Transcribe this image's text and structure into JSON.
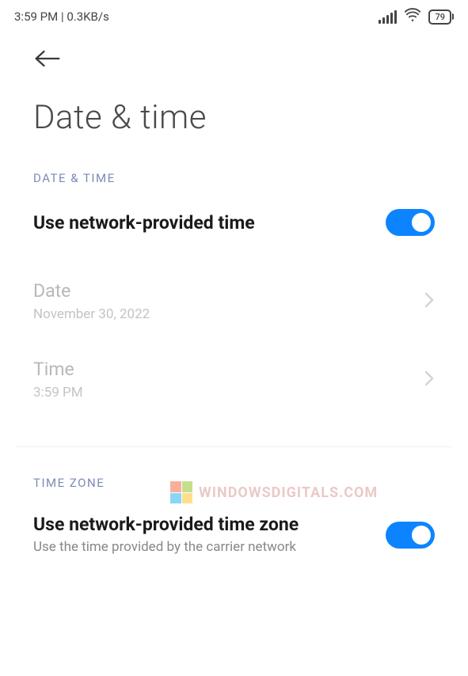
{
  "status_bar": {
    "time": "3:59 PM",
    "data_rate": "0.3KB/s",
    "battery": "79"
  },
  "page": {
    "title": "Date & time"
  },
  "sections": {
    "date_time": {
      "header": "DATE & TIME",
      "use_network_time": {
        "label": "Use network-provided time",
        "enabled": true
      },
      "date": {
        "label": "Date",
        "value": "November 30, 2022"
      },
      "time": {
        "label": "Time",
        "value": "3:59 PM"
      }
    },
    "time_zone": {
      "header": "TIME ZONE",
      "use_network_zone": {
        "label": "Use network-provided time zone",
        "subtitle": "Use the time provided by the carrier network",
        "enabled": true
      }
    }
  },
  "watermark": {
    "text": "WINDOWSDIGITALS.COM"
  }
}
